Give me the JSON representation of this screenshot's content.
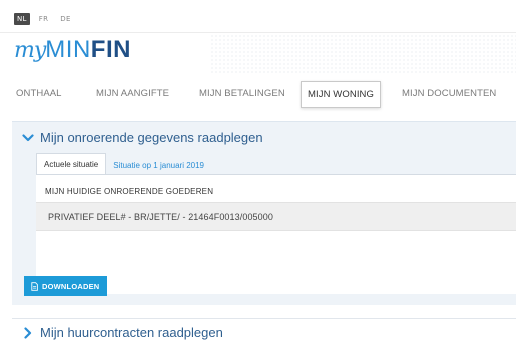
{
  "languages": [
    {
      "code": "NL",
      "active": true
    },
    {
      "code": "FR",
      "active": false
    },
    {
      "code": "DE",
      "active": false
    }
  ],
  "logo": {
    "my": "my",
    "min": "MIN",
    "fin": "FIN"
  },
  "nav": {
    "tabs": [
      {
        "label": "ONTHAAL",
        "active": false
      },
      {
        "label": "MIJN AANGIFTE",
        "active": false
      },
      {
        "label": "MIJN BETALINGEN",
        "active": false
      },
      {
        "label": "MIJN WONING",
        "active": true
      },
      {
        "label": "MIJN DOCUMENTEN",
        "active": false
      }
    ]
  },
  "section": {
    "title": "Mijn onroerende gegevens raadplegen",
    "expanded": true,
    "subtabs": [
      {
        "label": "Actuele situatie",
        "active": true
      },
      {
        "label": "Situatie op 1 januari 2019",
        "active": false
      }
    ],
    "property_label": "MIJN HUIDIGE ONROERENDE GOEDEREN",
    "property_item": "PRIVATIEF DEEL# - BR/JETTE/ - 21464F0013/005000",
    "download_label": "DOWNLOADEN"
  },
  "section2": {
    "title": "Mijn huurcontracten raadplegen",
    "expanded": false
  },
  "colors": {
    "accent": "#2a8dd4",
    "brand_dark": "#1f4f86",
    "button": "#1d9bd8",
    "section_bg": "#eef3f8"
  },
  "icons": [
    "chevron-down-icon",
    "chevron-right-icon",
    "document-icon"
  ]
}
